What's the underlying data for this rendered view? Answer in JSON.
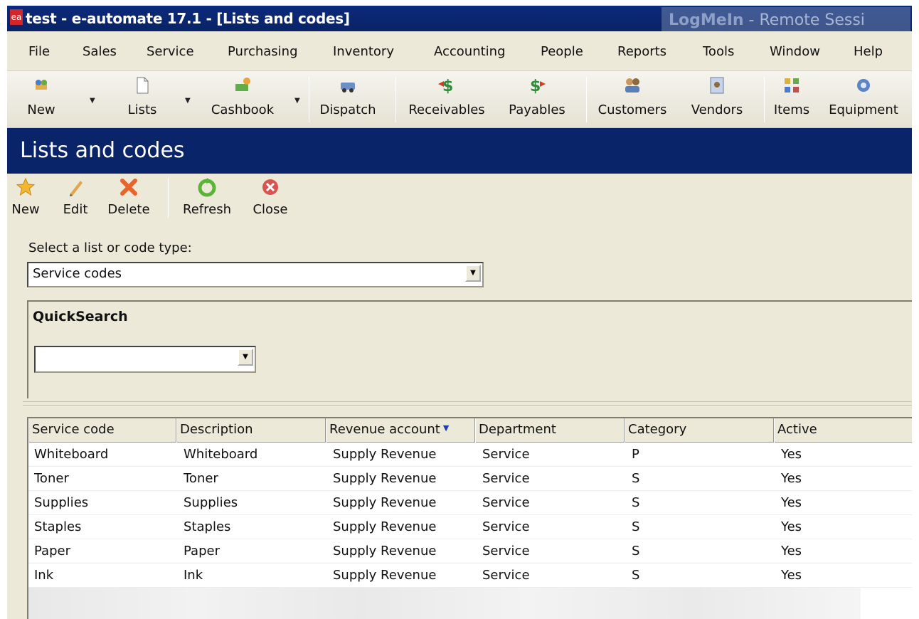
{
  "window": {
    "app_icon": "ea",
    "title": "test - e-automate 17.1 - [Lists and codes]",
    "overlay_brand": "LogMeIn",
    "overlay_text": "-  Remote Sessi"
  },
  "menu": {
    "items": [
      "File",
      "Sales",
      "Service",
      "Purchasing",
      "Inventory",
      "Accounting",
      "People",
      "Reports",
      "Tools",
      "Window",
      "Help"
    ]
  },
  "toolbar": {
    "buttons": [
      {
        "label": "New",
        "icon": "new-icon"
      },
      {
        "label": "Lists",
        "icon": "lists-icon"
      },
      {
        "label": "Cashbook",
        "icon": "cashbook-icon"
      },
      {
        "label": "Dispatch",
        "icon": "dispatch-icon"
      },
      {
        "label": "Receivables",
        "icon": "receivables-icon"
      },
      {
        "label": "Payables",
        "icon": "payables-icon"
      },
      {
        "label": "Customers",
        "icon": "customers-icon"
      },
      {
        "label": "Vendors",
        "icon": "vendors-icon"
      },
      {
        "label": "Items",
        "icon": "items-icon"
      },
      {
        "label": "Equipment",
        "icon": "equipment-icon"
      }
    ]
  },
  "page": {
    "title": "Lists and codes"
  },
  "actions": {
    "new": "New",
    "edit": "Edit",
    "delete": "Delete",
    "refresh": "Refresh",
    "close": "Close"
  },
  "list_selector": {
    "label": "Select a list or code type:",
    "value": "Service codes"
  },
  "quicksearch": {
    "title": "QuickSearch",
    "value": ""
  },
  "grid": {
    "columns": [
      "Service code",
      "Description",
      "Revenue account",
      "Department",
      "Category",
      "Active"
    ],
    "sorted_column": "Revenue account",
    "rows": [
      [
        "Whiteboard",
        "Whiteboard",
        "Supply Revenue",
        "Service",
        "P",
        "Yes"
      ],
      [
        "Toner",
        "Toner",
        "Supply Revenue",
        "Service",
        "S",
        "Yes"
      ],
      [
        "Supplies",
        "Supplies",
        "Supply Revenue",
        "Service",
        "S",
        "Yes"
      ],
      [
        "Staples",
        "Staples",
        "Supply Revenue",
        "Service",
        "S",
        "Yes"
      ],
      [
        "Paper",
        "Paper",
        "Supply Revenue",
        "Service",
        "S",
        "Yes"
      ],
      [
        "Ink",
        "Ink",
        "Supply Revenue",
        "Service",
        "S",
        "Yes"
      ]
    ]
  },
  "colors": {
    "title_bar": "#0a2366",
    "header_band": "#0a246a",
    "panel": "#ece9d8",
    "app_icon": "#d2262a"
  }
}
